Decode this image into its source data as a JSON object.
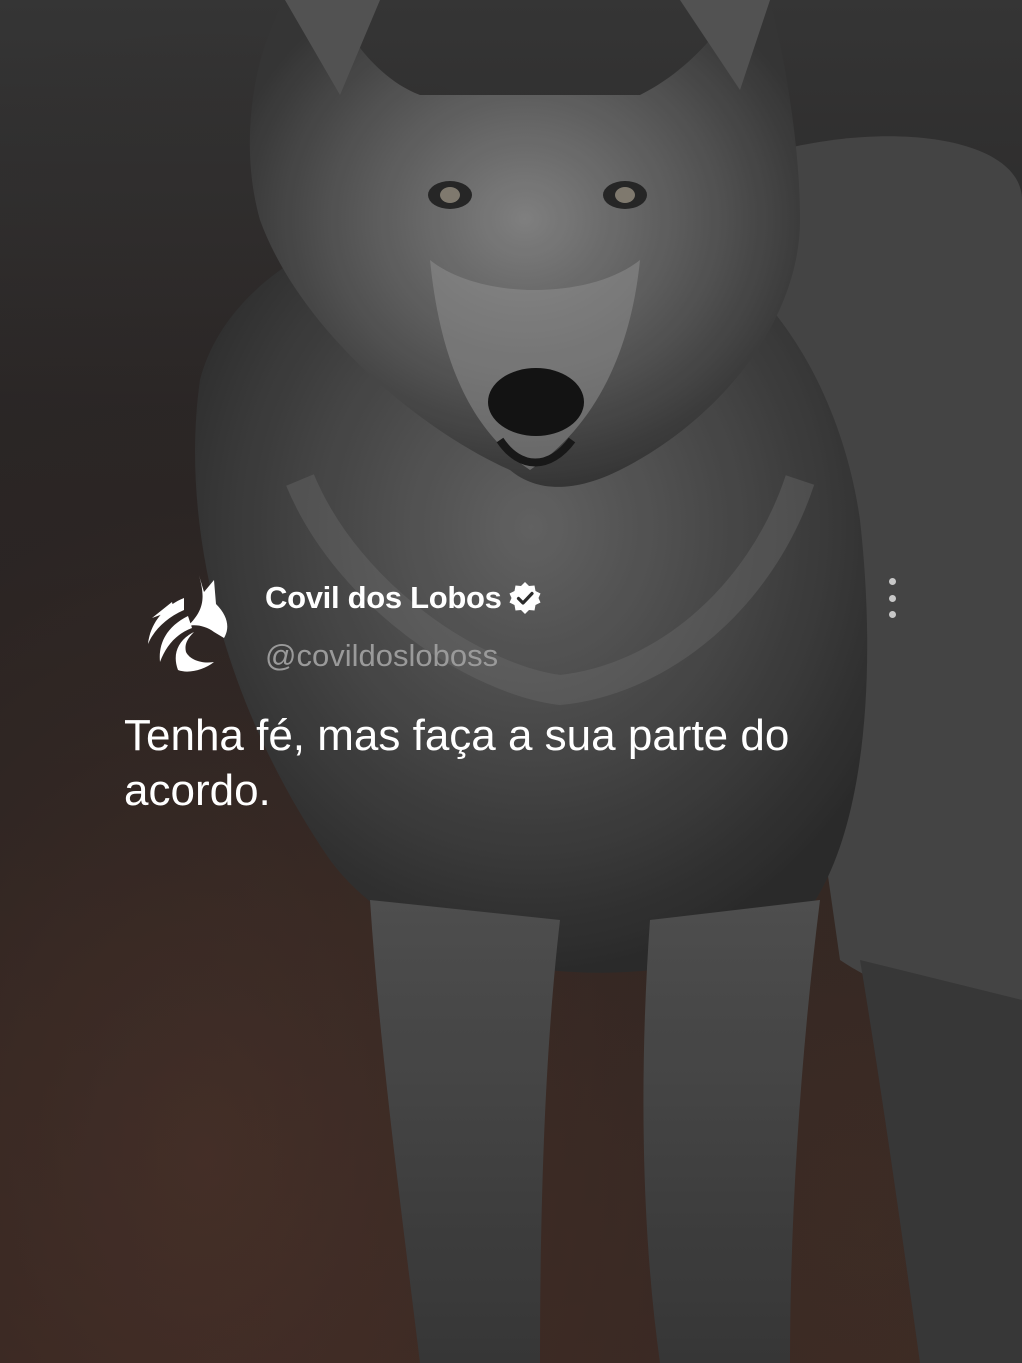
{
  "post": {
    "author": {
      "display_name": "Covil dos Lobos",
      "handle": "@covildosloboss",
      "verified": true,
      "avatar_icon": "wolf-logo-icon",
      "verified_icon": "verified-badge-icon"
    },
    "text": "Tenha fé, mas faça a sua parte do acordo.",
    "menu_icon": "more-vertical-icon"
  },
  "background": {
    "subject": "wolf-photo"
  },
  "colors": {
    "text_primary": "#ffffff",
    "text_secondary": "#9a9a9a",
    "background": "#2c2a2a"
  }
}
